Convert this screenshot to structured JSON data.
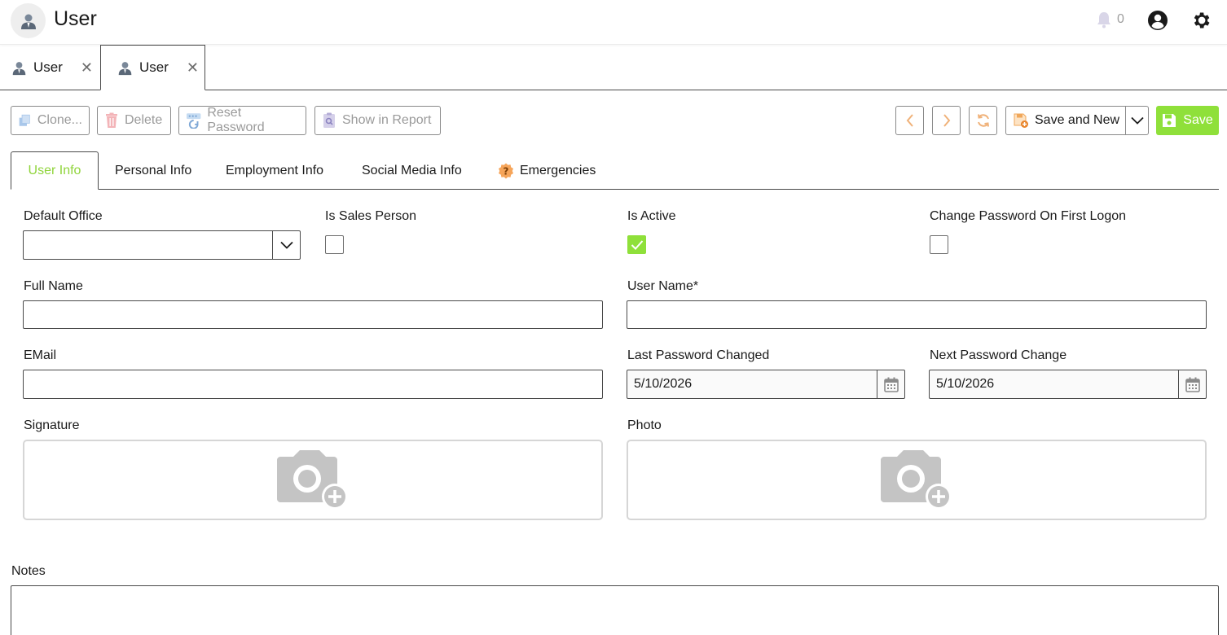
{
  "header": {
    "title": "User",
    "notification_count": "0"
  },
  "doc_tabs": [
    {
      "label": "User",
      "close": "✕"
    },
    {
      "label": "User",
      "close": "✕"
    }
  ],
  "toolbar": {
    "clone": "Clone...",
    "delete": "Delete",
    "reset_password": "Reset Password",
    "show_in_report": "Show in Report",
    "save_and_new": "Save and New",
    "save": "Save"
  },
  "section_tabs": [
    {
      "label": "User Info"
    },
    {
      "label": "Personal Info"
    },
    {
      "label": "Employment Info"
    },
    {
      "label": "Social Media Info"
    },
    {
      "label": "Emergencies"
    }
  ],
  "form": {
    "default_office": {
      "label": "Default Office",
      "value": ""
    },
    "is_sales_person": {
      "label": "Is Sales Person",
      "checked": false
    },
    "is_active": {
      "label": "Is Active",
      "checked": true
    },
    "change_password": {
      "label": "Change Password On First Logon",
      "checked": false
    },
    "full_name": {
      "label": "Full Name",
      "value": ""
    },
    "user_name": {
      "label": "User Name*",
      "value": ""
    },
    "email": {
      "label": "EMail",
      "value": ""
    },
    "last_password_changed": {
      "label": "Last Password Changed",
      "value": "5/10/2026"
    },
    "next_password_change": {
      "label": "Next Password Change",
      "value": "5/10/2026"
    },
    "signature": {
      "label": "Signature"
    },
    "photo": {
      "label": "Photo"
    },
    "notes": {
      "label": "Notes",
      "value": ""
    }
  },
  "colors": {
    "accent_green": "#8fe03a",
    "border": "#4a4a4a",
    "muted_text": "#9a9a9a"
  },
  "icons": {
    "app": "user-avatar-icon",
    "notification": "bell-icon",
    "account": "account-circle-icon",
    "settings": "gear-icon",
    "calendar": "calendar-icon",
    "image_add": "camera-add-icon"
  }
}
